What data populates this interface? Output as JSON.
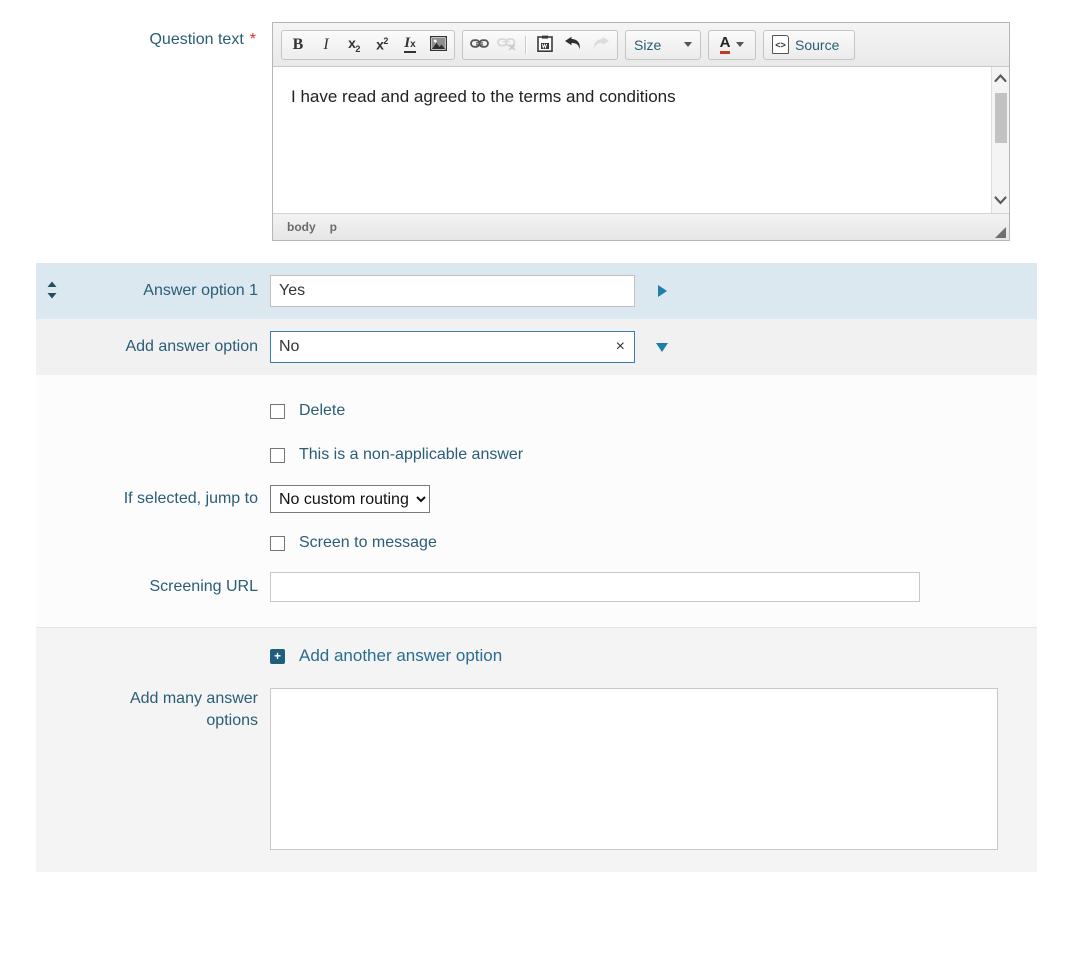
{
  "question": {
    "label": "Question text",
    "required_marker": "*",
    "editor": {
      "content": "I have read and agreed to the terms and conditions",
      "toolbar": {
        "bold": "B",
        "italic": "I",
        "subscript_base": "x",
        "subscript_sup": "2",
        "superscript_base": "x",
        "superscript_sup": "2",
        "remove_format": "I",
        "remove_format_sub": "x",
        "image_icon": "image-icon",
        "link_icon": "link-icon",
        "unlink_icon": "unlink-icon",
        "paste_icon": "paste-from-word-icon",
        "undo_icon": "undo-icon",
        "redo_icon": "redo-icon",
        "size_label": "Size",
        "color_label": "A",
        "source_label": "Source"
      },
      "element_path": [
        "body",
        "p"
      ],
      "scrollbar": {
        "up": "⌃",
        "down": "⌄"
      }
    }
  },
  "answer_options": {
    "rows": [
      {
        "label": "Answer option 1",
        "value": "Yes",
        "has_drag_handle": true,
        "drag_glyph": "↕",
        "expanded": false,
        "has_clear": false
      },
      {
        "label": "Add answer option",
        "value": "No",
        "has_drag_handle": false,
        "expanded": true,
        "has_clear": true,
        "clear_glyph": "×",
        "placeholder": ""
      }
    ],
    "detail": {
      "delete_label": "Delete",
      "delete_checked": false,
      "non_applicable_label": "This is a non-applicable answer",
      "non_applicable_checked": false,
      "jump_to_label": "If selected, jump to",
      "jump_to_value": "No custom routing",
      "jump_to_options": [
        "No custom routing"
      ],
      "screen_to_message_label": "Screen to message",
      "screen_to_message_checked": false,
      "screening_url_label": "Screening URL",
      "screening_url_value": "",
      "screening_url_placeholder": ""
    },
    "bottom": {
      "add_another_label": "Add another answer option",
      "add_another_icon": "plus-square-icon",
      "many_label_line1": "Add many answer",
      "many_label_line2": "options",
      "many_value": "",
      "many_placeholder": ""
    }
  },
  "colors": {
    "accent_blue": "#2a5d77",
    "link_blue": "#2a6d90",
    "row_highlight": "#dce8ef",
    "row_grey": "#f1f1f1",
    "panel_white": "#fcfcfc",
    "bottom_grey": "#f4f4f4",
    "required_red": "#d9302c",
    "caret_blue": "#1f7fab"
  }
}
